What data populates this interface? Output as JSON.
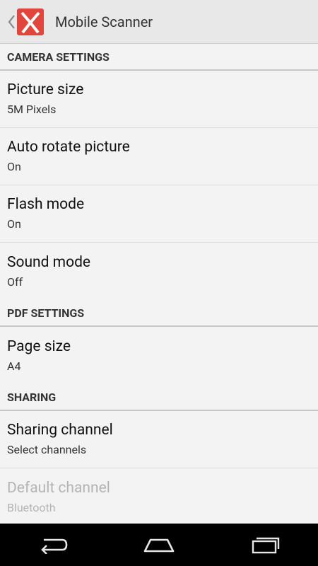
{
  "app": {
    "title": "Mobile Scanner",
    "logo_icon": "scanner-app-logo-icon",
    "logo_color": "#e2453c"
  },
  "sections": {
    "camera": {
      "header": "CAMERA SETTINGS",
      "items": [
        {
          "title": "Picture size",
          "summary": "5M Pixels"
        },
        {
          "title": "Auto rotate picture",
          "summary": "On"
        },
        {
          "title": "Flash mode",
          "summary": "On"
        },
        {
          "title": "Sound mode",
          "summary": "Off"
        }
      ]
    },
    "pdf": {
      "header": "PDF SETTINGS",
      "items": [
        {
          "title": "Page size",
          "summary": "A4"
        }
      ]
    },
    "sharing": {
      "header": "SHARING",
      "items": [
        {
          "title": "Sharing channel",
          "summary": "Select channels"
        },
        {
          "title": "Default channel",
          "summary": "Bluetooth",
          "disabled": true
        }
      ]
    }
  },
  "nav": {
    "back_icon": "back-icon",
    "home_icon": "home-icon",
    "recents_icon": "recents-icon"
  }
}
